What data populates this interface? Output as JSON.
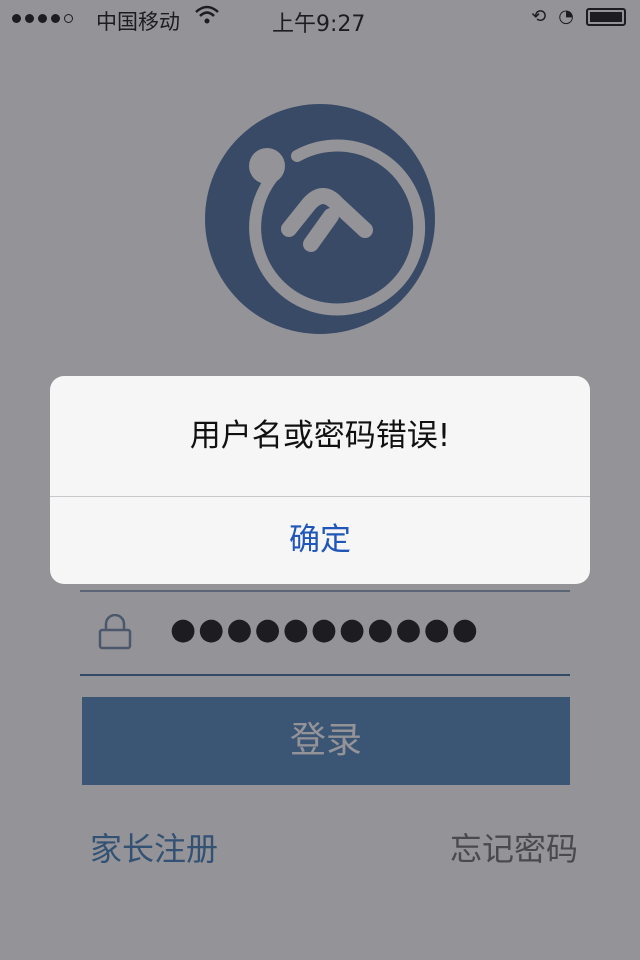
{
  "status_bar": {
    "carrier": "中国移动",
    "time": "上午9:27",
    "wifi_icon": "wifi-icon",
    "battery_icon": "battery-icon"
  },
  "logo": {
    "icon": "app-logo-icon",
    "colors": {
      "circle": "#4a6d9c",
      "mark": "#ffffff"
    }
  },
  "login_form": {
    "password_value": "●●●●●●●●●●●",
    "lock_icon": "lock-icon",
    "login_label": "登录",
    "register_link": "家长注册",
    "forgot_link": "忘记密码"
  },
  "alert": {
    "message": "用户名或密码错误!",
    "confirm_label": "确定"
  },
  "colors": {
    "accent": "#4e82b9",
    "alert_button": "#1f56b8"
  }
}
